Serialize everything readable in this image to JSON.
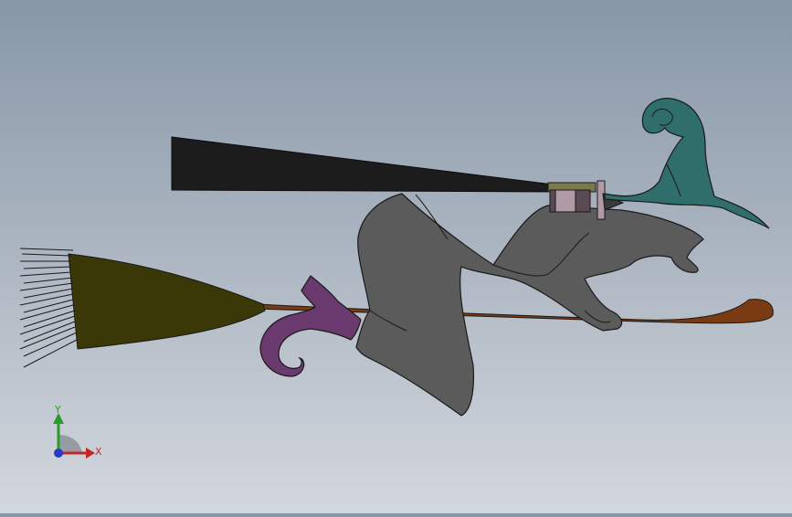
{
  "viewport": {
    "model_name": "flying-witch-on-broomstick",
    "background_top": "#8797a8",
    "background_bottom": "#d3d7de"
  },
  "colors": {
    "body": "#5b5b5b",
    "outline": "#1a1a1a",
    "hat": "#2f6e6b",
    "boot": "#6a3a6e",
    "broom_handle": "#7a3a12",
    "bristles": "#3a3806",
    "scarf": "#1c1c1c",
    "buckle": "#5a4a52",
    "buckle_band": "#7a7a4a"
  },
  "triad": {
    "x_label": "X",
    "y_label": "Y",
    "x_color": "#c0282a",
    "y_color": "#2a9a2a",
    "z_color": "#2a3ac0"
  }
}
